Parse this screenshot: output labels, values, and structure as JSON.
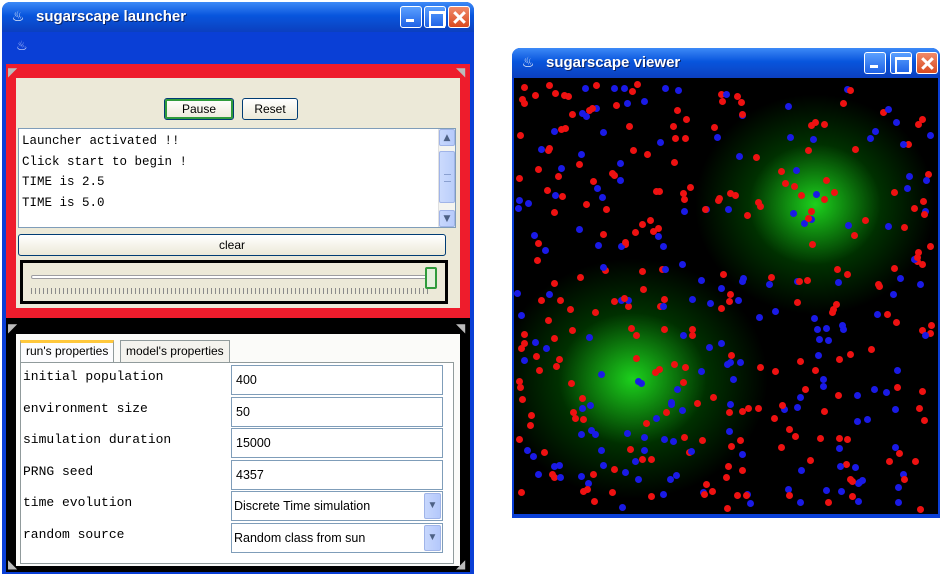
{
  "launcher": {
    "title": "sugarscape launcher",
    "buttons": {
      "pause": "Pause",
      "reset": "Reset",
      "clear": "clear"
    },
    "log_lines": [
      "Launcher activated !!",
      "Click start to begin !",
      "TIME is 2.5",
      "TIME is 5.0"
    ],
    "slider_value": 1.0,
    "tabs": [
      {
        "label": "run's properties",
        "active": true
      },
      {
        "label": "model's properties",
        "active": false
      }
    ],
    "properties": [
      {
        "label": "initial population",
        "value": "400"
      },
      {
        "label": "environment size",
        "value": "50"
      },
      {
        "label": "simulation duration",
        "value": "15000"
      },
      {
        "label": "PRNG seed",
        "value": "4357"
      },
      {
        "label": "time evolution",
        "value": "Discrete Time simulation"
      },
      {
        "label": "random source",
        "value": "Random class from sun"
      }
    ]
  },
  "viewer": {
    "title": "sugarscape viewer",
    "agent_colors": [
      "#ee1111",
      "#1a1ae6"
    ],
    "background_color": "#000000",
    "sugar_color": "#22dd22"
  },
  "icons": [
    "java-icon",
    "minimize-icon",
    "maximize-icon",
    "close-icon",
    "scroll-up-icon",
    "scroll-down-icon",
    "dropdown-arrow-icon"
  ]
}
